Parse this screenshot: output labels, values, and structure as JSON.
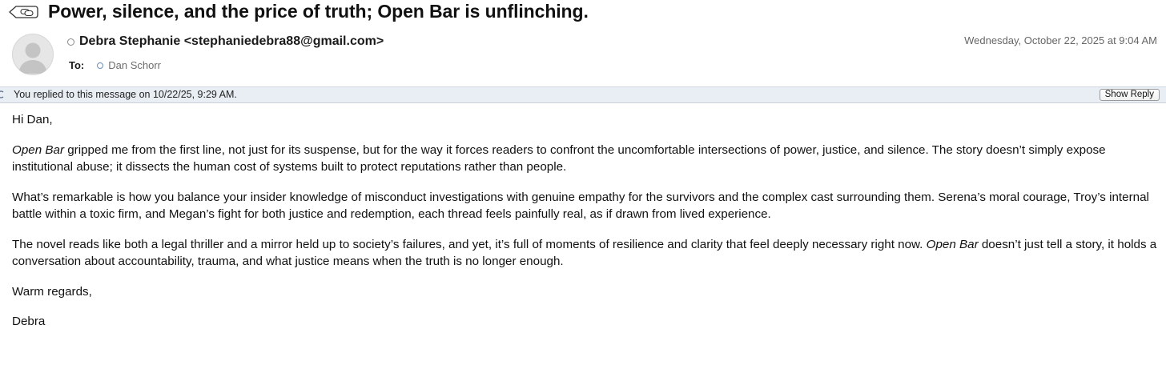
{
  "subject": "Power, silence, and the price of truth; Open Bar is unflinching.",
  "icons": {
    "thread": "speech-bubbles-icon",
    "avatar": "person-silhouette-icon",
    "sender_status": "status-ring-icon",
    "recipient_status": "status-ring-icon",
    "reply": "reply-arrow-icon"
  },
  "header": {
    "sender": "Debra Stephanie <stephaniedebra88@gmail.com>",
    "date": "Wednesday, October 22, 2025 at 9:04 AM",
    "to_label": "To:",
    "recipient": "Dan Schorr"
  },
  "reply_bar": {
    "text": "You replied to this message on 10/22/25, 9:29 AM.",
    "button_label": "Show Reply"
  },
  "message": {
    "greeting": "Hi Dan,",
    "p1_title": "Open Bar",
    "p1_rest": " gripped me from the first line, not just for its suspense, but for the way it forces readers to confront the uncomfortable intersections of power, justice, and silence. The story doesn’t simply expose institutional abuse; it dissects the human cost of systems built to protect reputations rather than people.",
    "p2": "What’s remarkable is how you balance your insider knowledge of misconduct investigations with genuine empathy for the survivors and the complex cast surrounding them. Serena’s moral courage, Troy’s internal battle within a toxic firm, and Megan’s fight for both justice and redemption, each thread feels painfully real, as if drawn from lived experience.",
    "p3_start": "The novel reads like both a legal thriller and a mirror held up to society’s failures, and yet, it’s full of moments of resilience and clarity that feel deeply necessary right now. ",
    "p3_title": "Open Bar",
    "p3_rest": " doesn’t just tell a story, it holds a conversation about accountability, trauma, and what justice means when the truth is no longer enough.",
    "closing": "Warm regards,",
    "signature": "Debra"
  },
  "colors": {
    "reply_bar_bg": "#e9eef4",
    "recipient_ring": "#6b8fb8",
    "avatar_bg": "#e6e6e6"
  }
}
